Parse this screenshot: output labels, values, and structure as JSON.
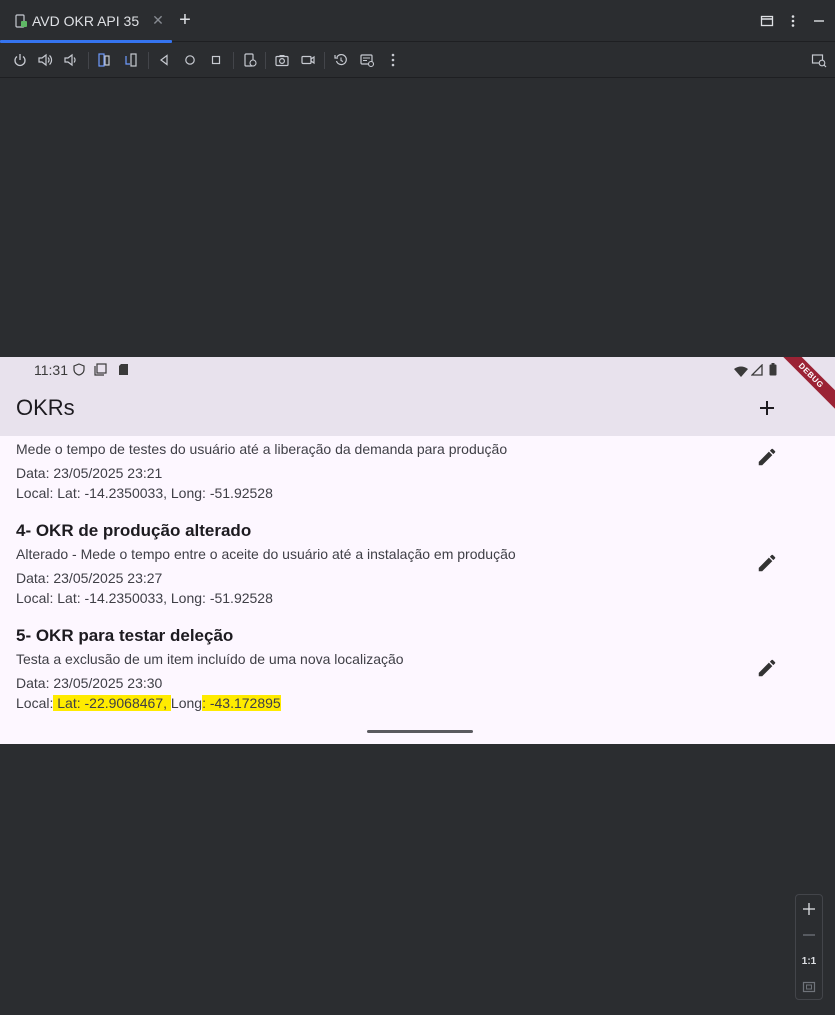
{
  "tab": {
    "title": "AVD OKR API 35"
  },
  "icons": {
    "tab": "device-icon",
    "close": "close-icon",
    "add_tab": "plus-icon",
    "window": [
      "layout-icon",
      "more-vert-icon"
    ],
    "toolbar": [
      "power-icon",
      "volume-up-icon",
      "volume-down-icon",
      "rotate-left-icon",
      "rotate-right-icon",
      "back-icon",
      "home-icon",
      "overview-icon",
      "snapshot-icon",
      "screenshot-icon",
      "screen-record-icon",
      "reset-icon",
      "extended-controls-icon",
      "more-icon",
      "device-mirror-icon"
    ]
  },
  "device": {
    "status_time": "11:31",
    "debug_label": "DEBUG",
    "app_title": "OKRs",
    "items": [
      {
        "title": "",
        "description": "Mede o tempo de testes do usuário até a liberação da demanda para produção",
        "date": "Data: 23/05/2025 23:21",
        "location": "Local: Lat: -14.2350033, Long: -51.92528"
      },
      {
        "title": "4- OKR de produção alterado",
        "description": "Alterado - Mede o tempo entre o aceite do usuário até a instalação em produção",
        "date": "Data: 23/05/2025 23:27",
        "location": "Local: Lat: -14.2350033, Long: -51.92528"
      },
      {
        "title": "5- OKR para testar deleção",
        "description": "Testa a exclusão de um item incluído de uma nova localização",
        "date": "Data: 23/05/2025 23:30",
        "location_prefix": "Local:",
        "location_lat": " Lat: -22.9068467, ",
        "location_mid": "Long",
        "location_long": ": -43.172895"
      }
    ]
  },
  "zoom": {
    "one_to_one": "1:1"
  },
  "colors": {
    "accent": "#3574f0",
    "highlight": "#ffeb00",
    "appbar": "#e8e2ed",
    "ide_bg": "#2b2d30"
  }
}
